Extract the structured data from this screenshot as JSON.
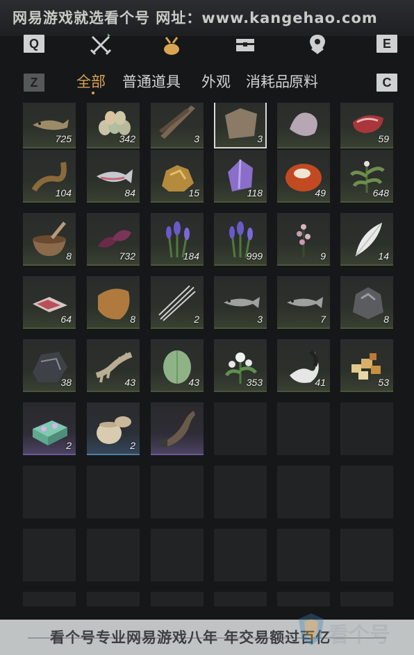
{
  "watermark": {
    "top_text": "网易游戏就选看个号  网址：www.kangehao.com",
    "bottom_text": "看个号专业网易游戏八年  年交易额过百亿",
    "logo_text": "看个号"
  },
  "keys": {
    "q": "Q",
    "e": "E",
    "z": "Z",
    "c": "C"
  },
  "categories": [
    "crossed-swords-icon",
    "pouch-icon",
    "chest-icon",
    "map-marker-icon"
  ],
  "subtabs": [
    "全部",
    "普通道具",
    "外观",
    "消耗品",
    "原料"
  ],
  "active_subtab": "全部",
  "colors": {
    "accent": "#d9a552",
    "cell_green": "#384031",
    "cell_purple": "#4a4260",
    "cell_blue": "#34465a"
  },
  "items": [
    {
      "icon": "dried-fish-icon",
      "count": "725"
    },
    {
      "icon": "eggs-icon",
      "count": "342"
    },
    {
      "icon": "feathers-icon",
      "count": "3"
    },
    {
      "icon": "hide-icon",
      "count": "3",
      "selected": true
    },
    {
      "icon": "bird-carcass-icon",
      "count": ""
    },
    {
      "icon": "raw-meat-icon",
      "count": "59"
    },
    {
      "icon": "eel-icon",
      "count": "104"
    },
    {
      "icon": "salmon-icon",
      "count": "84"
    },
    {
      "icon": "gold-ore-icon",
      "count": "15"
    },
    {
      "icon": "amethyst-icon",
      "count": "118"
    },
    {
      "icon": "agate-icon",
      "count": "49"
    },
    {
      "icon": "herb-icon",
      "count": "648"
    },
    {
      "icon": "mortar-icon",
      "count": "8"
    },
    {
      "icon": "purple-leaves-icon",
      "count": "732"
    },
    {
      "icon": "lavender-icon",
      "count": "184"
    },
    {
      "icon": "lavender-icon",
      "count": "999"
    },
    {
      "icon": "pink-flower-icon",
      "count": "9"
    },
    {
      "icon": "white-feather-icon",
      "count": "14"
    },
    {
      "icon": "meat-slices-icon",
      "count": "64"
    },
    {
      "icon": "fur-pelt-icon",
      "count": "8"
    },
    {
      "icon": "quills-icon",
      "count": "2"
    },
    {
      "icon": "grey-fish-icon",
      "count": "3"
    },
    {
      "icon": "grey-fish-icon",
      "count": "7"
    },
    {
      "icon": "dark-ore-icon",
      "count": "8"
    },
    {
      "icon": "black-stone-icon",
      "count": "38"
    },
    {
      "icon": "bone-icon",
      "count": "43"
    },
    {
      "icon": "green-gourd-icon",
      "count": "43"
    },
    {
      "icon": "white-flower-icon",
      "count": "353"
    },
    {
      "icon": "tail-fur-icon",
      "count": "41"
    },
    {
      "icon": "crystals-icon",
      "count": "53"
    },
    {
      "icon": "pastry-box-icon",
      "count": "2",
      "rarity": "purple"
    },
    {
      "icon": "ceramic-jar-icon",
      "count": "2",
      "rarity": "blue"
    },
    {
      "icon": "horn-icon",
      "count": "",
      "rarity": "purple"
    }
  ]
}
